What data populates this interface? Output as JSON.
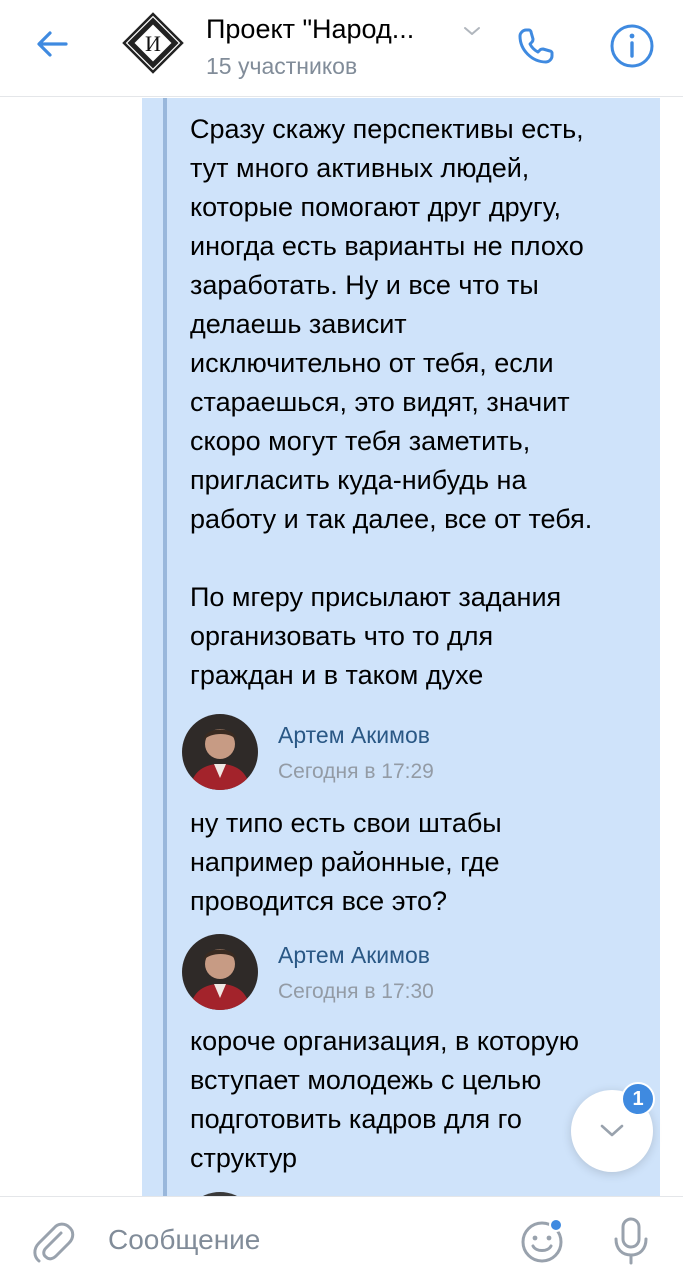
{
  "header": {
    "title": "Проект \"Народ...",
    "subtitle": "15 участников",
    "avatar_letter": "И",
    "icons": {
      "back": "arrow-left-icon",
      "chevron": "chevron-down-icon",
      "call": "phone-icon",
      "info": "info-icon"
    }
  },
  "messages": {
    "first": {
      "lines": [
        "Сразу скажу перспективы есть,",
        "тут много активных людей,",
        "которые помогают друг другу,",
        "иногда есть варианты не плохо",
        "заработать. Ну и все что ты",
        "делаешь зависит",
        "исключительно от тебя, если",
        "стараешься, это видят, значит",
        "скоро могут тебя заметить,",
        "пригласить куда-нибудь на",
        "работу и так далее, все от тебя."
      ],
      "lines2": [
        "По мгеру присылают задания",
        "организовать что то для",
        "граждан и в таком духе"
      ]
    },
    "second": {
      "author": "Артем Акимов",
      "time": "Сегодня в 17:29",
      "lines": [
        "ну типо есть свои штабы",
        "например районные, где",
        "проводится все это?"
      ]
    },
    "third": {
      "author": "Артем Акимов",
      "time": "Сегодня в 17:30",
      "lines": [
        "короче организация, в которую",
        "вступает молодежь с целью",
        "подготовить кадров для го",
        "структур"
      ]
    }
  },
  "scroll_down": {
    "unread_count": "1"
  },
  "composer": {
    "placeholder": "Сообщение"
  },
  "colors": {
    "accent": "#3f8ae0",
    "selected_background": "#cfe3fa",
    "author_name": "#2a5885",
    "secondary_text": "#818c99"
  }
}
